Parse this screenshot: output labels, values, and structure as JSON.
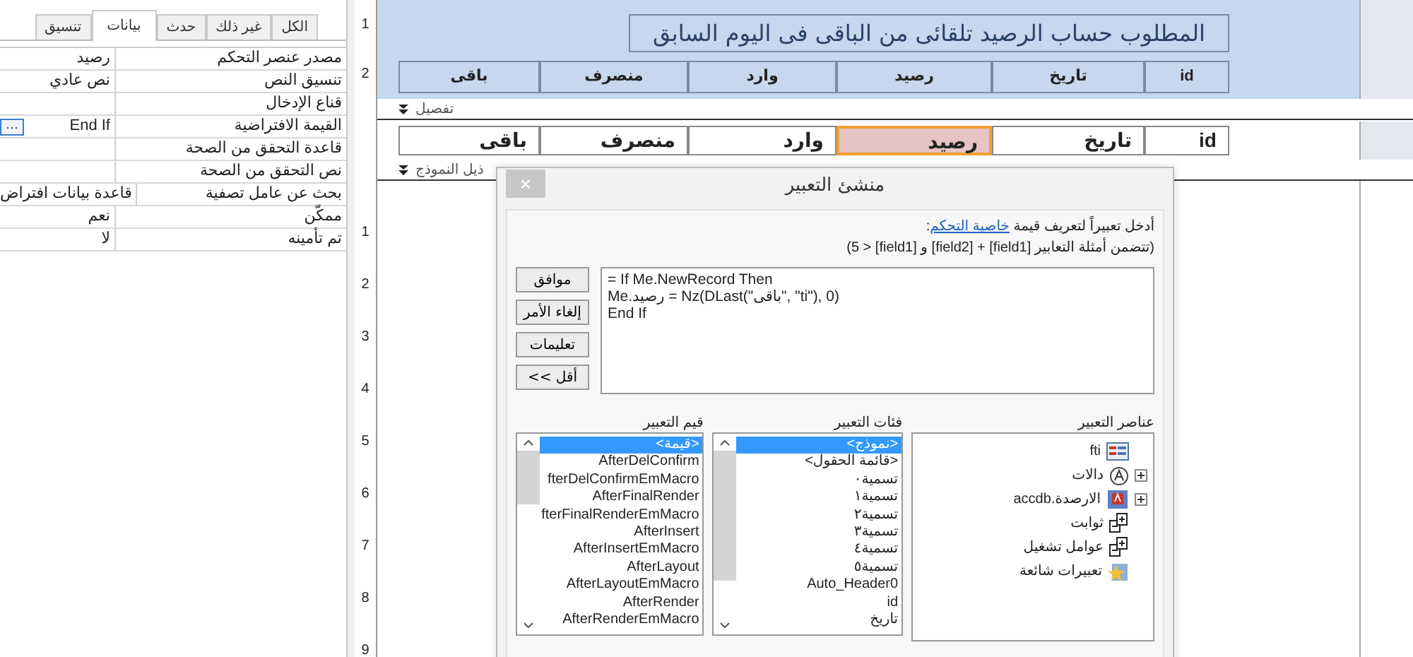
{
  "property_sheet": {
    "tabs": [
      {
        "label": "الكل",
        "selected": false
      },
      {
        "label": "غير ذلك",
        "selected": false
      },
      {
        "label": "حدث",
        "selected": false
      },
      {
        "label": "بيانات",
        "selected": true
      },
      {
        "label": "تنسيق",
        "selected": false
      }
    ],
    "rows": [
      {
        "name": "مصدر عنصر التحكم",
        "value": "رصيد"
      },
      {
        "name": "تنسيق النص",
        "value": "نص عادي"
      },
      {
        "name": "قناع الإدخال"
      },
      {
        "name": "القيمة الافتراضية",
        "value": "End If",
        "button": "···"
      },
      {
        "name": "قاعدة التحقق من الصحة"
      },
      {
        "name": "نص التحقق من الصحة"
      },
      {
        "name": "بحث عن عامل تصفية",
        "value": "قاعدة بيانات افتراض"
      },
      {
        "name": "ممكّن",
        "value": "نعم"
      },
      {
        "name": "تم تأمينه",
        "value": "لا"
      }
    ]
  },
  "form_design": {
    "header_ruler": [
      "1",
      "2"
    ],
    "title": "المطلوب حساب الرصيد تلقائى من الباقى فى اليوم السابق",
    "header_labels": [
      "id",
      "تاريخ",
      "رصيد",
      "وارد",
      "منصرف",
      "باقى"
    ],
    "detail_bar": "تفصيل",
    "detail_fields": [
      {
        "text": "id",
        "selected": false
      },
      {
        "text": "تاريخ",
        "selected": false
      },
      {
        "text": "رصيد",
        "selected": true
      },
      {
        "text": "وارد",
        "selected": false
      },
      {
        "text": "منصرف",
        "selected": false
      },
      {
        "text": "باقى",
        "selected": false
      }
    ],
    "footer_bar": "ذيل النموذج",
    "footer_ruler": [
      "1",
      "2",
      "3",
      "4",
      "5",
      "6",
      "7",
      "8",
      "9"
    ]
  },
  "dialog": {
    "close": "×",
    "title": "منشئ التعبير",
    "prompt": "أدخل تعبيراً لتعريف قيمة",
    "prompt_link": "خاصية التحكم",
    "prompt_end": ":",
    "example": "(تتضمن أمثلة التعابير [field1] + [field2] و [field1] < 5)",
    "buttons": [
      "موافق",
      "إلغاء الأمر",
      "تعليمات",
      "<< أقل"
    ],
    "expression": [
      "= If Me.NewRecord Then",
      "Me.رصيد = Nz(DLast(\"باقى\", \"ti\"), 0)",
      "End If"
    ],
    "elements": {
      "label": "عناصر التعبير",
      "items": [
        {
          "text": "fti",
          "kind": "form"
        },
        {
          "text": "دالات",
          "kind": "functions"
        },
        {
          "text": "الارصدة.accdb",
          "kind": "database"
        },
        {
          "text": "ثوابت",
          "kind": "constants"
        },
        {
          "text": "عوامل تشغيل",
          "kind": "operators"
        },
        {
          "text": "تعبيرات شائعة",
          "kind": "common"
        }
      ]
    },
    "categories": {
      "label": "فئات التعبير",
      "items": [
        {
          "text": "<نموذج>",
          "selected": true
        },
        {
          "text": "<قائمة الحقول>",
          "selected": false
        },
        {
          "text": "تسمية٠",
          "selected": false
        },
        {
          "text": "تسمية١",
          "selected": false
        },
        {
          "text": "تسمية٢",
          "selected": false
        },
        {
          "text": "تسمية٣",
          "selected": false
        },
        {
          "text": "تسمية٤",
          "selected": false
        },
        {
          "text": "تسمية٥",
          "selected": false
        },
        {
          "text": "Auto_Header0",
          "selected": false
        },
        {
          "text": "id",
          "selected": false
        },
        {
          "text": "تاريخ",
          "selected": false
        }
      ]
    },
    "values": {
      "label": "قيم التعبير",
      "items": [
        {
          "text": "<قيمة>",
          "selected": true
        },
        {
          "text": "AfterDelConfirm",
          "selected": false
        },
        {
          "text": "fterDelConfirmEmMacro",
          "selected": false
        },
        {
          "text": "AfterFinalRender",
          "selected": false
        },
        {
          "text": "fterFinalRenderEmMacro",
          "selected": false
        },
        {
          "text": "AfterInsert",
          "selected": false
        },
        {
          "text": "AfterInsertEmMacro",
          "selected": false
        },
        {
          "text": "AfterLayout",
          "selected": false
        },
        {
          "text": "AfterLayoutEmMacro",
          "selected": false
        },
        {
          "text": "AfterRender",
          "selected": false
        },
        {
          "text": "AfterRenderEmMacro",
          "selected": false
        }
      ]
    }
  }
}
